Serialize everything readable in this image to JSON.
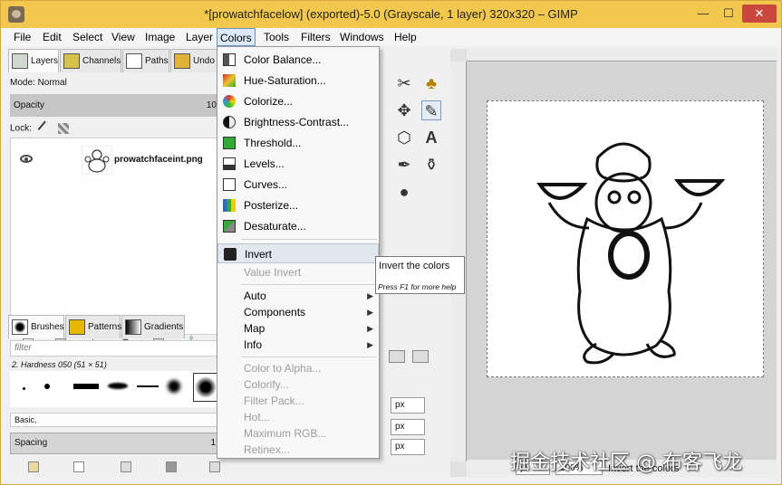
{
  "window": {
    "title": "*[prowatchfacelow] (exported)-5.0 (Grayscale, 1 layer) 320x320 – GIMP",
    "controls": {
      "minimize": "—",
      "maximize": "☐",
      "close": "✕"
    }
  },
  "menubar": {
    "items": [
      "File",
      "Edit",
      "Select",
      "View",
      "Image",
      "Layer",
      "Colors",
      "Tools",
      "Filters",
      "Windows",
      "Help"
    ],
    "active": "Colors"
  },
  "layers_dock": {
    "tabs": [
      "Layers",
      "Channels",
      "Paths",
      "Undo"
    ],
    "mode": "Mode: Normal",
    "opacity_label": "Opacity",
    "opacity_value": "10",
    "lock_label": "Lock:",
    "layer_name": "prowatchfaceint.png"
  },
  "brushes_dock": {
    "tabs": [
      "Brushes",
      "Patterns",
      "Gradients"
    ],
    "filter_placeholder": "filter",
    "brush_name": "2. Hardness 050 (51 × 51)",
    "preset": "Basic,",
    "spacing_label": "Spacing",
    "spacing_value": "1"
  },
  "colors_menu": {
    "group1": [
      {
        "label": "Color Balance...",
        "icon": "color-balance-icon"
      },
      {
        "label": "Hue-Saturation...",
        "icon": "hue-saturation-icon"
      },
      {
        "label": "Colorize...",
        "icon": "colorize-icon"
      },
      {
        "label": "Brightness-Contrast...",
        "icon": "brightness-contrast-icon"
      },
      {
        "label": "Threshold...",
        "icon": "threshold-icon"
      },
      {
        "label": "Levels...",
        "icon": "levels-icon"
      },
      {
        "label": "Curves...",
        "icon": "curves-icon"
      },
      {
        "label": "Posterize...",
        "icon": "posterize-icon"
      },
      {
        "label": "Desaturate...",
        "icon": "desaturate-icon"
      }
    ],
    "invert": "Invert",
    "value_invert": "Value Invert",
    "submenus": [
      "Auto",
      "Components",
      "Map",
      "Info"
    ],
    "disabled_items": [
      "Color to Alpha...",
      "Colorify...",
      "Filter Pack...",
      "Hot...",
      "Maximum RGB...",
      "Retinex..."
    ]
  },
  "tooltip": {
    "title": "Invert the colors",
    "help": "Press F1 for more help"
  },
  "tool_options": {
    "unit_1": "px",
    "unit_2": "px",
    "unit_3": "px"
  },
  "canvas": {
    "unit": "px",
    "zoom": "100%",
    "status": "Invert the colors"
  },
  "watermark": "掘金技术社区 @ 布客飞龙"
}
